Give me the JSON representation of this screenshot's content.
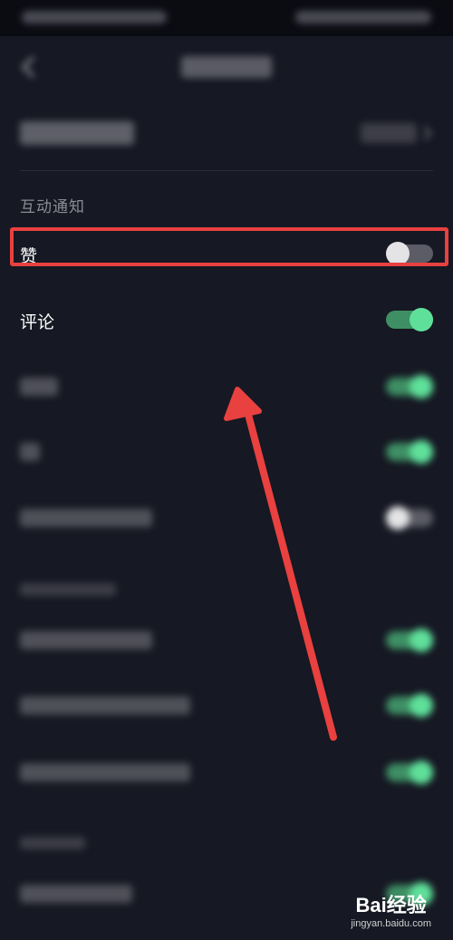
{
  "section_interaction": "互动通知",
  "rows": {
    "like": {
      "label": "赞",
      "toggle_on": false
    },
    "comment": {
      "label": "评论",
      "toggle_on": true
    }
  },
  "colors": {
    "background": "#161823",
    "toggle_on": "#5fe09a",
    "toggle_off_knob": "#e4e4e6",
    "highlight": "#e8413f",
    "arrow": "#e8413f"
  },
  "watermark": {
    "logo": "Bai经验",
    "url": "jingyan.baidu.com"
  }
}
